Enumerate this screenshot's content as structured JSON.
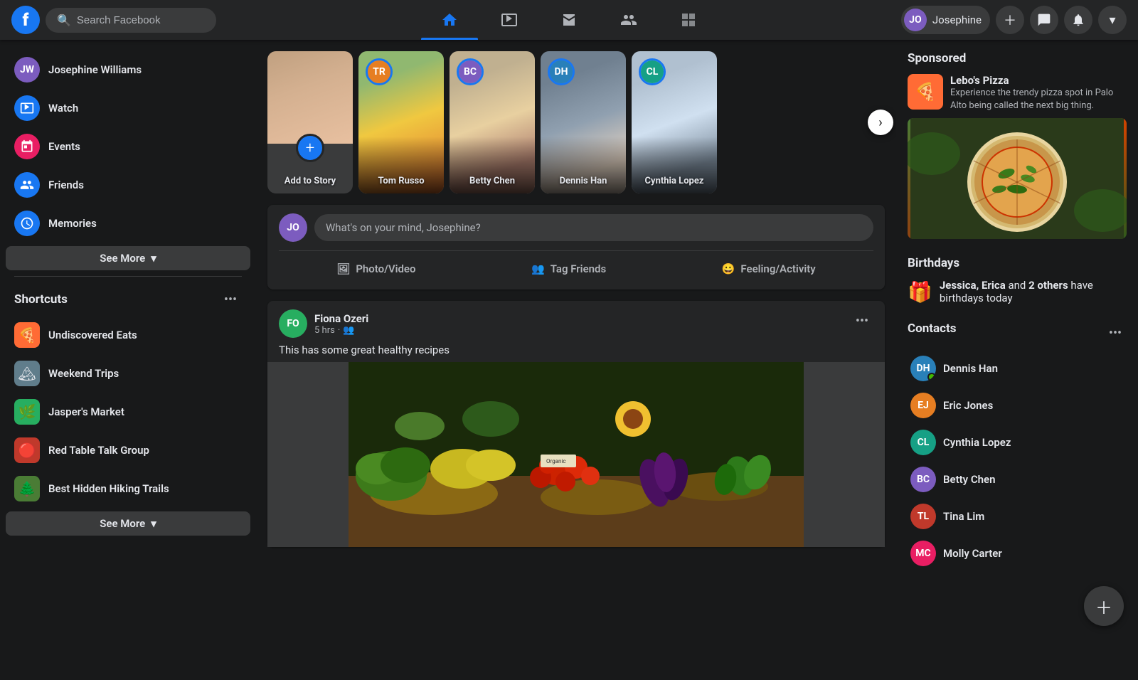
{
  "app": {
    "title": "Facebook",
    "logo": "f"
  },
  "topnav": {
    "search_placeholder": "Search Facebook",
    "user_name": "Josephine",
    "tabs": [
      {
        "id": "home",
        "label": "🏠",
        "active": true
      },
      {
        "id": "watch",
        "label": "▶",
        "active": false
      },
      {
        "id": "marketplace",
        "label": "🏪",
        "active": false
      },
      {
        "id": "groups",
        "label": "👥",
        "active": false
      },
      {
        "id": "pages",
        "label": "⊞",
        "active": false
      }
    ],
    "actions": {
      "plus": "+",
      "messenger": "💬",
      "bell": "🔔",
      "chevron": "▾"
    }
  },
  "sidebar_left": {
    "user": {
      "name": "Josephine Williams",
      "avatar_initials": "JW"
    },
    "menu_items": [
      {
        "id": "watch",
        "label": "Watch",
        "icon": "▶",
        "icon_bg": "#1877f2"
      },
      {
        "id": "events",
        "label": "Events",
        "icon": "★",
        "icon_bg": "#e91e63"
      },
      {
        "id": "friends",
        "label": "Friends",
        "icon": "👥",
        "icon_bg": "#1877f2"
      },
      {
        "id": "memories",
        "label": "Memories",
        "icon": "🕐",
        "icon_bg": "#1877f2"
      }
    ],
    "see_more_label": "See More",
    "shortcuts_title": "Shortcuts",
    "shortcuts": [
      {
        "id": "undiscovered-eats",
        "label": "Undiscovered Eats",
        "icon": "🍕"
      },
      {
        "id": "weekend-trips",
        "label": "Weekend Trips",
        "icon": "🏔"
      },
      {
        "id": "jaspers-market",
        "label": "Jasper's Market",
        "icon": "🌿"
      },
      {
        "id": "red-table-talk",
        "label": "Red Table Talk Group",
        "icon": "🔴"
      },
      {
        "id": "hidden-hiking",
        "label": "Best Hidden Hiking Trails",
        "icon": "🌲"
      }
    ],
    "see_more_shortcuts_label": "See More"
  },
  "stories": {
    "add_story_label": "Add to Story",
    "items": [
      {
        "id": "tom-russo",
        "name": "Tom Russo",
        "avatar_initials": "TR"
      },
      {
        "id": "betty-chen",
        "name": "Betty Chen",
        "avatar_initials": "BC"
      },
      {
        "id": "dennis-han",
        "name": "Dennis Han",
        "avatar_initials": "DH"
      },
      {
        "id": "cynthia-lopez",
        "name": "Cynthia Lopez",
        "avatar_initials": "CL"
      }
    ]
  },
  "post_box": {
    "placeholder": "What's on your mind, Josephine?",
    "actions": [
      {
        "id": "photo-video",
        "label": "Photo/Video",
        "icon": "🖼"
      },
      {
        "id": "tag-friends",
        "label": "Tag Friends",
        "icon": "👥"
      },
      {
        "id": "feeling",
        "label": "Feeling/Activity",
        "icon": "😀"
      }
    ]
  },
  "feed": {
    "posts": [
      {
        "id": "post-1",
        "author": "Fiona Ozeri",
        "author_initials": "FO",
        "time": "5 hrs",
        "visibility_icon": "👥",
        "content": "This has some great healthy recipes",
        "has_image": true,
        "image_type": "market"
      }
    ]
  },
  "sidebar_right": {
    "sponsored": {
      "title": "Sponsored",
      "ad_name": "Lebo's Pizza",
      "ad_desc": "Experience the trendy pizza spot in Palo Alto being called the next big thing."
    },
    "birthdays": {
      "title": "Birthdays",
      "text": " and ",
      "names": "Jessica, Erica",
      "suffix": "2 others",
      "message": " have birthdays today"
    },
    "contacts": {
      "title": "Contacts",
      "items": [
        {
          "id": "dennis-han",
          "name": "Dennis Han",
          "initials": "DH",
          "color": "av-blue",
          "online": true
        },
        {
          "id": "eric-jones",
          "name": "Eric Jones",
          "initials": "EJ",
          "color": "av-orange",
          "online": false
        },
        {
          "id": "cynthia-lopez",
          "name": "Cynthia Lopez",
          "initials": "CL",
          "color": "av-teal",
          "online": false
        },
        {
          "id": "betty-chen",
          "name": "Betty Chen",
          "initials": "BC",
          "color": "av-purple",
          "online": false
        },
        {
          "id": "tina-lim",
          "name": "Tina Lim",
          "initials": "TL",
          "color": "av-red",
          "online": false
        },
        {
          "id": "molly-carter",
          "name": "Molly Carter",
          "initials": "MC",
          "color": "av-pink",
          "online": false
        }
      ]
    }
  }
}
